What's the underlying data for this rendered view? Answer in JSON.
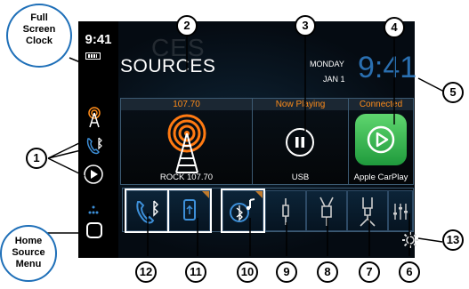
{
  "status": {
    "time": "9:41"
  },
  "header": {
    "title": "SOURCES",
    "ghost_title": "CES",
    "date_day": "MONDAY",
    "date_num": "JAN 1",
    "clock": "9:41"
  },
  "tiles": {
    "radio": {
      "head": "107.70",
      "foot": "ROCK 107.70"
    },
    "usb": {
      "head": "Now Playing",
      "foot": "USB"
    },
    "carplay": {
      "head": "Connected",
      "foot": "Apple CarPlay"
    }
  },
  "bottom_buttons": [
    {
      "icon": "bluetooth-phone-icon"
    },
    {
      "icon": "usb-drive-icon"
    },
    {
      "icon": "bluetooth-audio-icon"
    },
    {
      "icon": "aux-cable-icon"
    },
    {
      "icon": "usb-cable-icon"
    },
    {
      "icon": "charging-cable-icon"
    },
    {
      "icon": "equalizer-icon"
    }
  ],
  "callouts": [
    "1",
    "2",
    "3",
    "4",
    "5",
    "6",
    "7",
    "8",
    "9",
    "10",
    "11",
    "12",
    "13"
  ],
  "bubbles": {
    "clock": [
      "Full",
      "Screen",
      "Clock"
    ],
    "home": [
      "Home",
      "Source",
      "Menu"
    ]
  },
  "colors": {
    "accent_orange": "#ff8c1a",
    "clock_blue": "#2a6fb0",
    "carplay_green": "#2fa34a",
    "callout_blue": "#1e6fb8"
  }
}
